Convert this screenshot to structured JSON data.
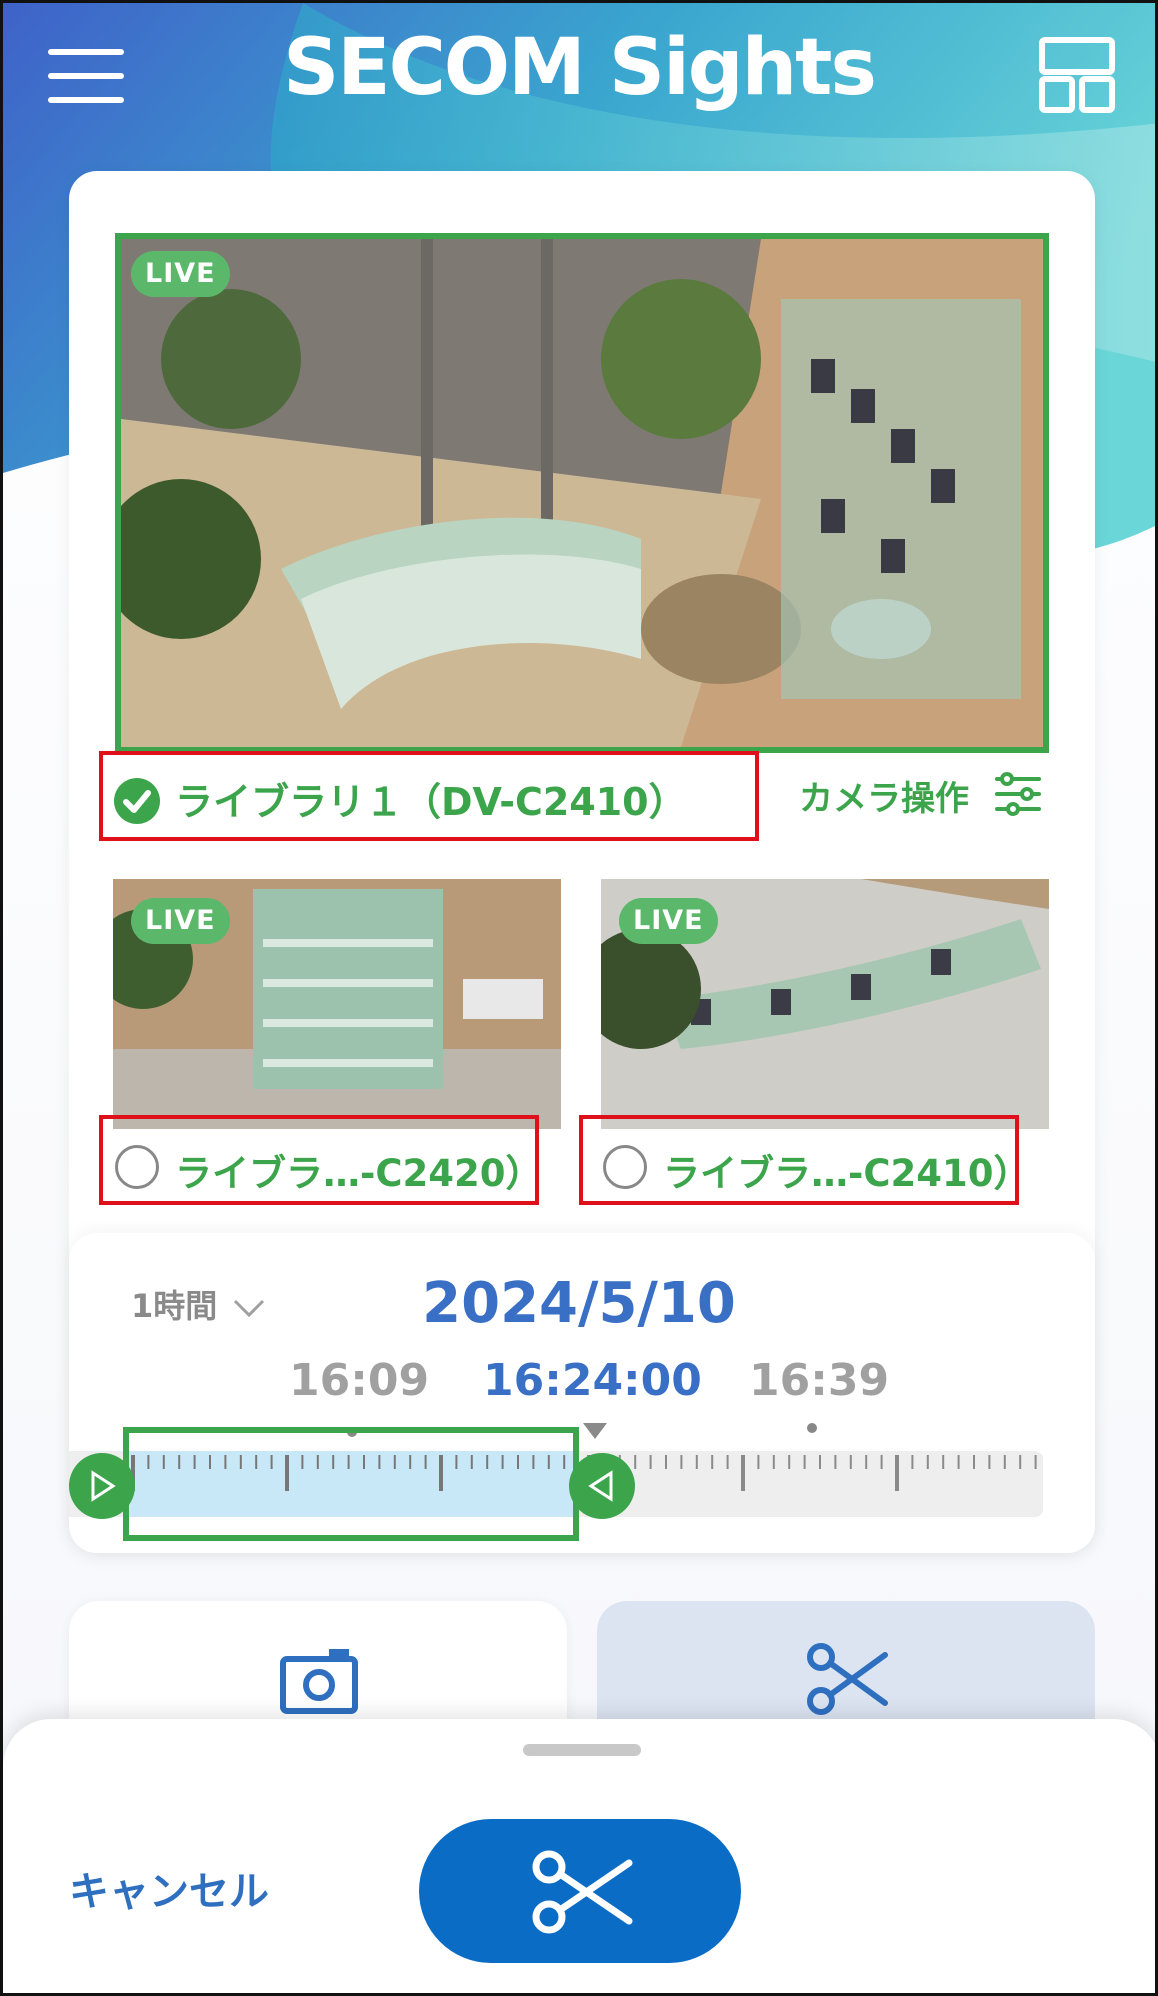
{
  "header": {
    "title": "SECOM Sights",
    "menu_icon": "hamburger-menu-icon",
    "layout_icon": "grid-layout-icon"
  },
  "main_camera": {
    "badge": "LIVE",
    "label": "ライブラリ１（DV-C2410）",
    "selected": true,
    "control_label": "カメラ操作",
    "control_icon": "sliders-icon"
  },
  "thumbnails": [
    {
      "badge": "LIVE",
      "label": "ライブラ…-C2420）",
      "selected": false
    },
    {
      "badge": "LIVE",
      "label": "ライブラ…-C2410）",
      "selected": false
    }
  ],
  "timeline": {
    "range": "1時間",
    "date": "2024/5/10",
    "times": {
      "left": "16:09",
      "center": "16:24:00",
      "right": "16:39"
    }
  },
  "actions": {
    "snapshot_icon": "camera-icon",
    "clip_icon": "scissors-icon"
  },
  "sheet": {
    "cancel": "キャンセル",
    "confirm_icon": "scissors-icon"
  },
  "colors": {
    "accent_green": "#3ca54c",
    "accent_blue": "#3a6fc6",
    "button_blue": "#0a6cc4",
    "highlight_red": "#e0101a"
  }
}
